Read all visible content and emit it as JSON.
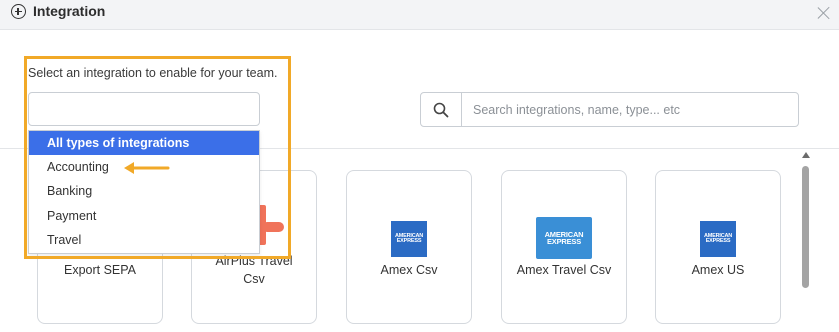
{
  "header": {
    "title": "Integration",
    "icon": "plus-circle-icon",
    "close_icon": "close-icon"
  },
  "filter": {
    "instruction": "Select an integration to enable for your team.",
    "select_value": "",
    "options": [
      "All types of integrations",
      "Accounting",
      "Banking",
      "Payment",
      "Travel"
    ],
    "selected_option": "All types of integrations"
  },
  "search": {
    "icon": "search-icon",
    "placeholder": "Search integrations, name, type... etc",
    "value": ""
  },
  "cards": [
    {
      "label": "Export SEPA"
    },
    {
      "label": "AirPlus Travel Csv"
    },
    {
      "label": "Amex Csv",
      "logo_text": [
        "AMERICAN",
        "EXPRESS"
      ]
    },
    {
      "label": "Amex Travel Csv",
      "logo_text": [
        "AMERICAN",
        "EXPRESS"
      ]
    },
    {
      "label": "Amex US",
      "logo_text": [
        "AMERICAN",
        "EXPRESS"
      ]
    }
  ],
  "annotation": {
    "highlight_color": "#f1a928",
    "arrow_icon": "arrow-left-icon",
    "pointed_item": "Accounting"
  },
  "colors": {
    "selected_bg": "#3b6fe8",
    "amex_blue": "#2b6bc4",
    "airplus_orange": "#f0735a"
  }
}
